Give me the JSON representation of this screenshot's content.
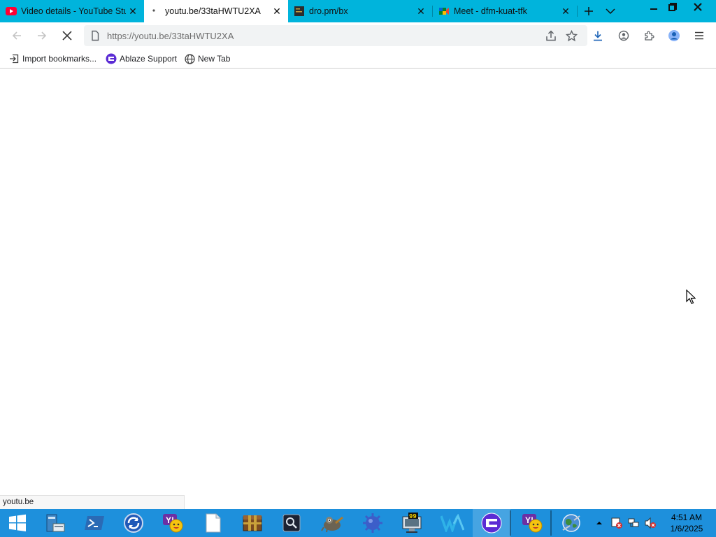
{
  "browser": {
    "tabs": [
      {
        "title": "Video details - YouTube Studio",
        "active": false,
        "favicon": "youtube-icon"
      },
      {
        "title": "youtu.be/33taHWTU2XA",
        "active": true,
        "favicon": "loading-dot-icon"
      },
      {
        "title": "dro.pm/bx",
        "active": false,
        "favicon": "dark-square-icon"
      },
      {
        "title": "Meet - dfm-kuat-tfk",
        "active": false,
        "favicon": "google-meet-icon"
      }
    ],
    "address": {
      "url": "https://youtu.be/33taHWTU2XA"
    },
    "bookmarks": [
      {
        "label": "Import bookmarks...",
        "icon": "import-icon"
      },
      {
        "label": "Ablaze Support",
        "icon": "ablaze-icon"
      },
      {
        "label": "New Tab",
        "icon": "globe-icon"
      }
    ],
    "status_text": "youtu.be",
    "accent_color": "#00b4dc"
  },
  "taskbar": {
    "color": "#1e90dc",
    "apps": [
      "start-icon",
      "server-manager-icon",
      "powershell-icon",
      "sync-icon",
      "yahoo-messenger-icon",
      "blank-file-icon",
      "archive-box-icon",
      "media-player-icon",
      "gimp-icon",
      "gear-ball-icon",
      "monitor-99-icon",
      "w-logo-icon",
      "ablaze-browser-icon",
      "yahoo-messenger-icon",
      "network-globe-icon"
    ],
    "clock": {
      "time": "4:51 AM",
      "date": "1/6/2025"
    }
  }
}
